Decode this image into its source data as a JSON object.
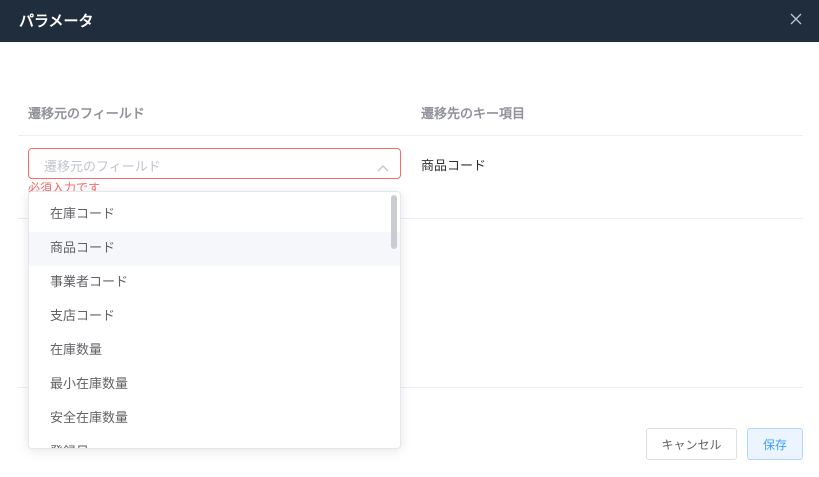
{
  "dialog": {
    "title": "パラメータ"
  },
  "table": {
    "headers": {
      "source_field": "遷移元のフィールド",
      "target_key": "遷移先のキー項目"
    },
    "rows": [
      {
        "select_placeholder": "遷移元のフィールド",
        "error": "必須入力です",
        "target_key": "商品コード"
      }
    ]
  },
  "dropdown": {
    "options": [
      {
        "label": "在庫コード"
      },
      {
        "label": "商品コード"
      },
      {
        "label": "事業者コード"
      },
      {
        "label": "支店コード"
      },
      {
        "label": "在庫数量"
      },
      {
        "label": "最小在庫数量"
      },
      {
        "label": "安全在庫数量"
      },
      {
        "label": "登録日"
      }
    ],
    "hovered_index": 1
  },
  "footer": {
    "cancel_label": "キャンセル",
    "save_label": "保存"
  },
  "colors": {
    "header_bg": "#1f2d3d",
    "error": "#f56c6c",
    "primary": "#409eff"
  }
}
